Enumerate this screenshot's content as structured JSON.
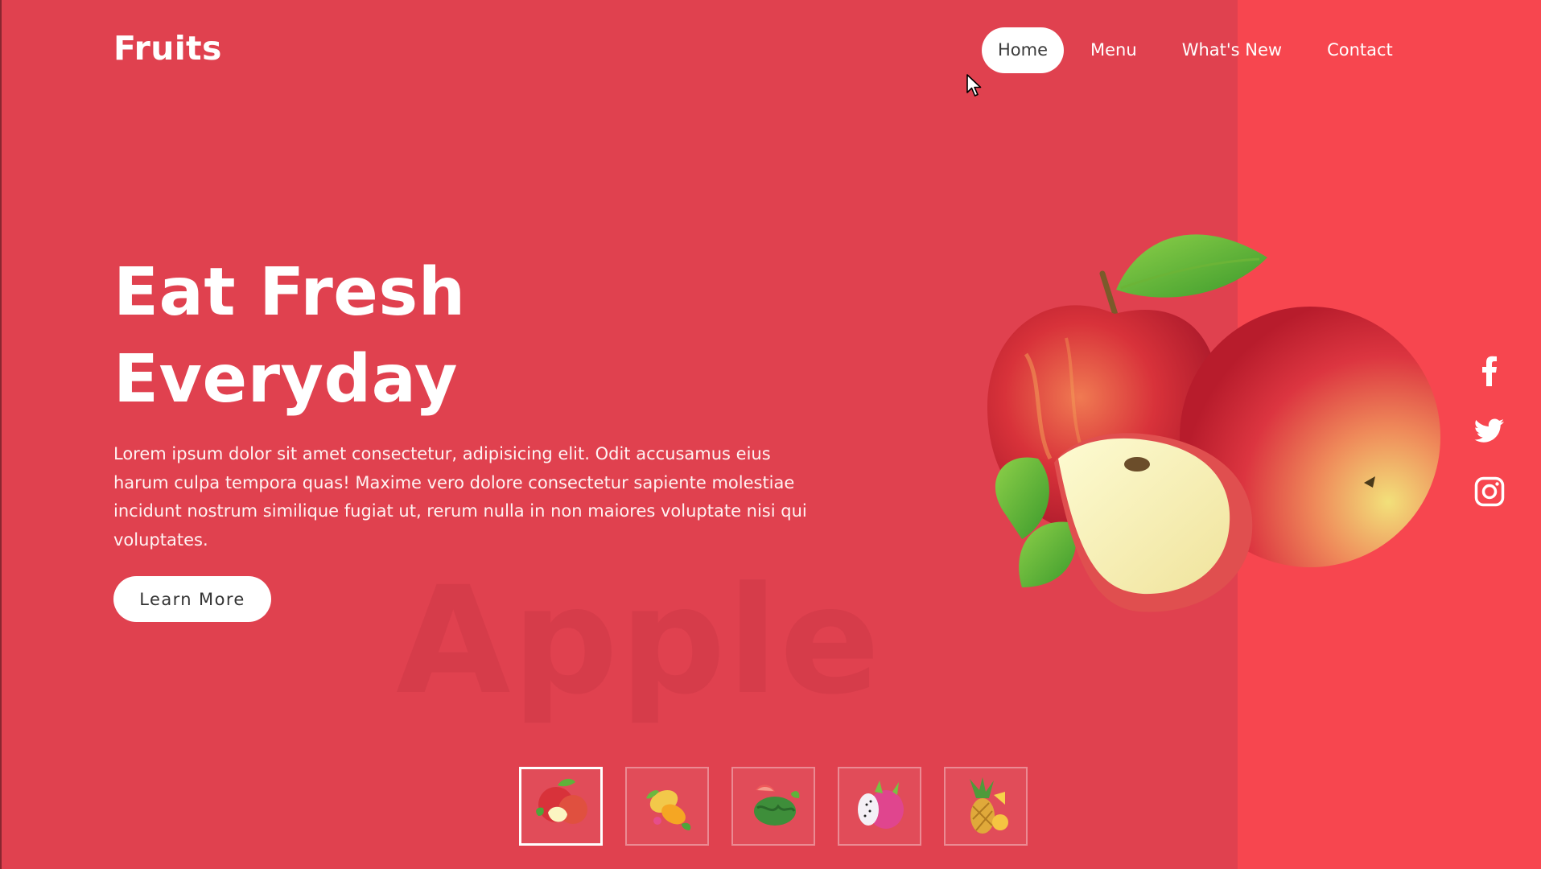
{
  "brand": {
    "name": "Fruits"
  },
  "nav": {
    "items": [
      {
        "label": "Home",
        "active": true
      },
      {
        "label": "Menu",
        "active": false
      },
      {
        "label": "What's New",
        "active": false
      },
      {
        "label": "Contact",
        "active": false
      }
    ]
  },
  "hero": {
    "title_line1": "Eat Fresh",
    "title_line2": "Everyday",
    "description": "Lorem ipsum dolor sit amet consectetur, adipisicing elit. Odit accusamus eius harum culpa tempora quas! Maxime vero dolore consectetur sapiente molestiae incidunt nostrum similique fugiat ut, rerum nulla in non maiores voluptate nisi qui voluptates.",
    "cta_label": "Learn More",
    "watermark": "Apple",
    "image_icon": "apples-image"
  },
  "social": [
    {
      "icon": "facebook-icon"
    },
    {
      "icon": "twitter-icon"
    },
    {
      "icon": "instagram-icon"
    }
  ],
  "thumbnails": [
    {
      "icon": "apple-thumbnail",
      "active": true
    },
    {
      "icon": "mango-thumbnail",
      "active": false
    },
    {
      "icon": "watermelon-thumbnail",
      "active": false
    },
    {
      "icon": "dragonfruit-thumbnail",
      "active": false
    },
    {
      "icon": "pineapple-thumbnail",
      "active": false
    }
  ],
  "colors": {
    "background": "#e0414f",
    "panel": "#f7464f",
    "text": "#ffffff",
    "button_text": "#333333"
  }
}
